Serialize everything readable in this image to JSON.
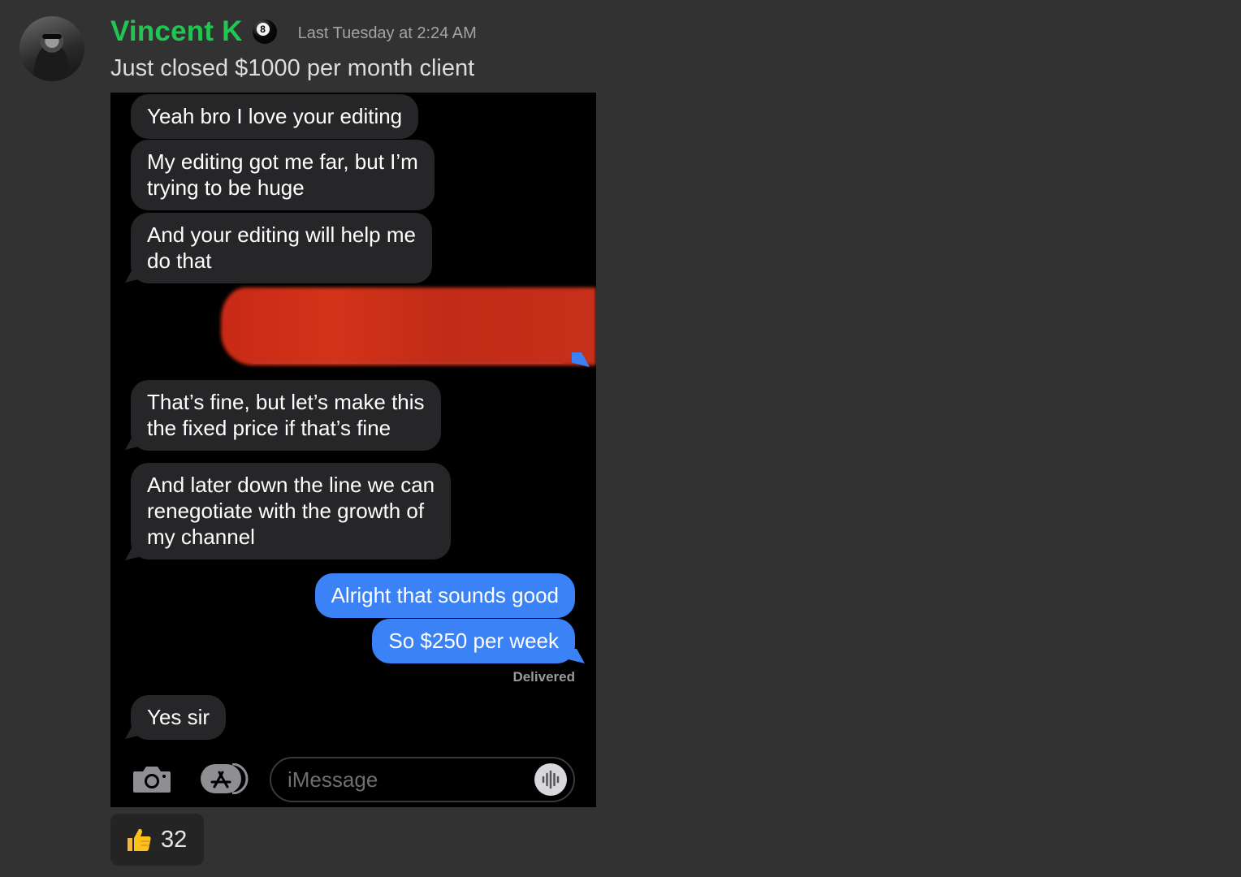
{
  "author": {
    "name": "Vincent K",
    "badge_icon": "8-ball-icon",
    "badge_label": "8",
    "timestamp": "Last Tuesday at 2:24 AM"
  },
  "message": {
    "text": "Just closed $1000 per month client"
  },
  "screenshot": {
    "bubbles": [
      {
        "direction": "in",
        "text": "Yeah bro I love your editing"
      },
      {
        "direction": "in",
        "text": "My editing got me far, but I’m\ntrying to be huge"
      },
      {
        "direction": "in",
        "text": "And your editing will help me\ndo that"
      },
      {
        "direction": "in",
        "text": "That’s fine, but let’s make this\nthe fixed price if that’s fine"
      },
      {
        "direction": "in",
        "text": "And later down the line we can\nrenegotiate with the growth of\nmy channel"
      },
      {
        "direction": "out",
        "text": "Alright that sounds good"
      },
      {
        "direction": "out",
        "text": "So $250 per week"
      },
      {
        "direction": "in",
        "text": "Yes sir"
      }
    ],
    "delivered_label": "Delivered",
    "composer": {
      "placeholder": "iMessage",
      "camera_icon": "camera-icon",
      "apps_icon": "app-store-icon",
      "audio_icon": "audio-waveform-icon"
    }
  },
  "reaction": {
    "emoji_icon": "thumbs-up-icon",
    "count": "32"
  },
  "colors": {
    "background": "#323233",
    "username": "#23c552",
    "incoming_bubble": "#262628",
    "outgoing_bubble": "#3b82f6",
    "redaction": "#c92a16"
  }
}
